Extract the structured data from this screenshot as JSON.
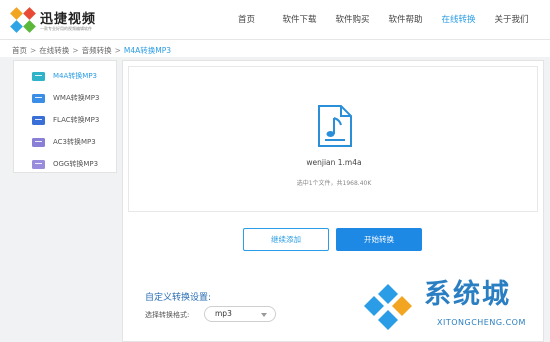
{
  "header": {
    "logo_title": "迅捷视频",
    "logo_subtitle": "一款专业好用的视频编辑软件",
    "nav": [
      {
        "label": "首页",
        "active": false
      },
      {
        "label": "软件下载",
        "active": false
      },
      {
        "label": "软件购买",
        "active": false
      },
      {
        "label": "软件帮助",
        "active": false
      },
      {
        "label": "在线转换",
        "active": true
      },
      {
        "label": "关于我们",
        "active": false
      }
    ]
  },
  "breadcrumb": {
    "items": [
      "首页",
      "在线转换",
      "音频转换"
    ],
    "current": "M4A转换MP3",
    "separator": ">"
  },
  "sidebar": {
    "items": [
      {
        "label": "M4A转换MP3",
        "icon": "m4a-file-icon",
        "color": "#2fb3c8",
        "active": true
      },
      {
        "label": "WMA转换MP3",
        "icon": "wma-file-icon",
        "color": "#3a8ee6",
        "active": false
      },
      {
        "label": "FLAC转换MP3",
        "icon": "flac-file-icon",
        "color": "#3a6fd8",
        "active": false
      },
      {
        "label": "AC3转换MP3",
        "icon": "ac3-file-icon",
        "color": "#8a7fd6",
        "active": false
      },
      {
        "label": "OGG转换MP3",
        "icon": "ogg-file-icon",
        "color": "#9a8cdc",
        "active": false
      }
    ]
  },
  "file": {
    "icon": "music-file-icon",
    "name": "wenjian 1.m4a",
    "info": "选中1个文件，共1968.40K"
  },
  "buttons": {
    "continue_add": "继续添加",
    "start_convert": "开始转换"
  },
  "settings": {
    "title": "自定义转换设置:",
    "format_label": "选择转换格式:",
    "format_value": "mp3"
  },
  "watermark": {
    "text": "系统城",
    "sub": "XITONGCHENG.COM"
  },
  "colors": {
    "accent": "#2a9de6",
    "primary_button": "#1e88e5",
    "background": "#f1f2f4"
  }
}
